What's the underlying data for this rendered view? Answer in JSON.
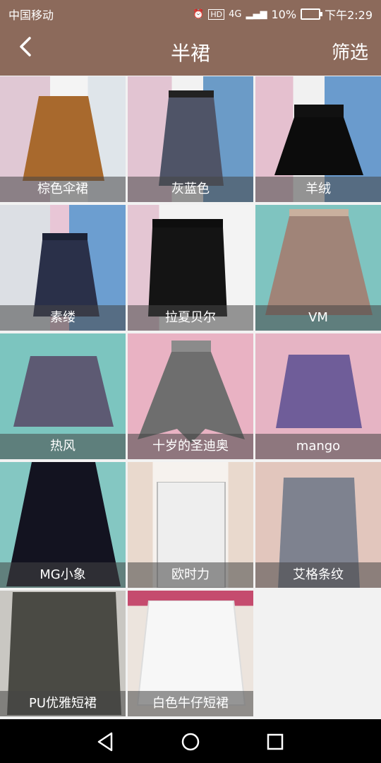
{
  "status_bar": {
    "carrier": "中国移动",
    "network": "4G",
    "battery": "10%",
    "time": "下午2:29"
  },
  "app_bar": {
    "back_icon": "chevron-left-icon",
    "title": "半裙",
    "filter_label": "筛选"
  },
  "colors": {
    "accent": "#8c6a5b"
  },
  "items": [
    {
      "label": "棕色伞裙"
    },
    {
      "label": "灰蓝色"
    },
    {
      "label": "羊绒"
    },
    {
      "label": "素缕"
    },
    {
      "label": "拉夏贝尔"
    },
    {
      "label": "VM"
    },
    {
      "label": "热风"
    },
    {
      "label": "十岁的圣迪奥"
    },
    {
      "label": "mango"
    },
    {
      "label": "MG小象"
    },
    {
      "label": "欧时力"
    },
    {
      "label": "艾格条纹"
    },
    {
      "label": "PU优雅短裙"
    },
    {
      "label": "白色牛仔短裙"
    }
  ],
  "nav": {
    "back_icon": "triangle-back-icon",
    "home_icon": "circle-home-icon",
    "recent_icon": "square-recents-icon"
  }
}
